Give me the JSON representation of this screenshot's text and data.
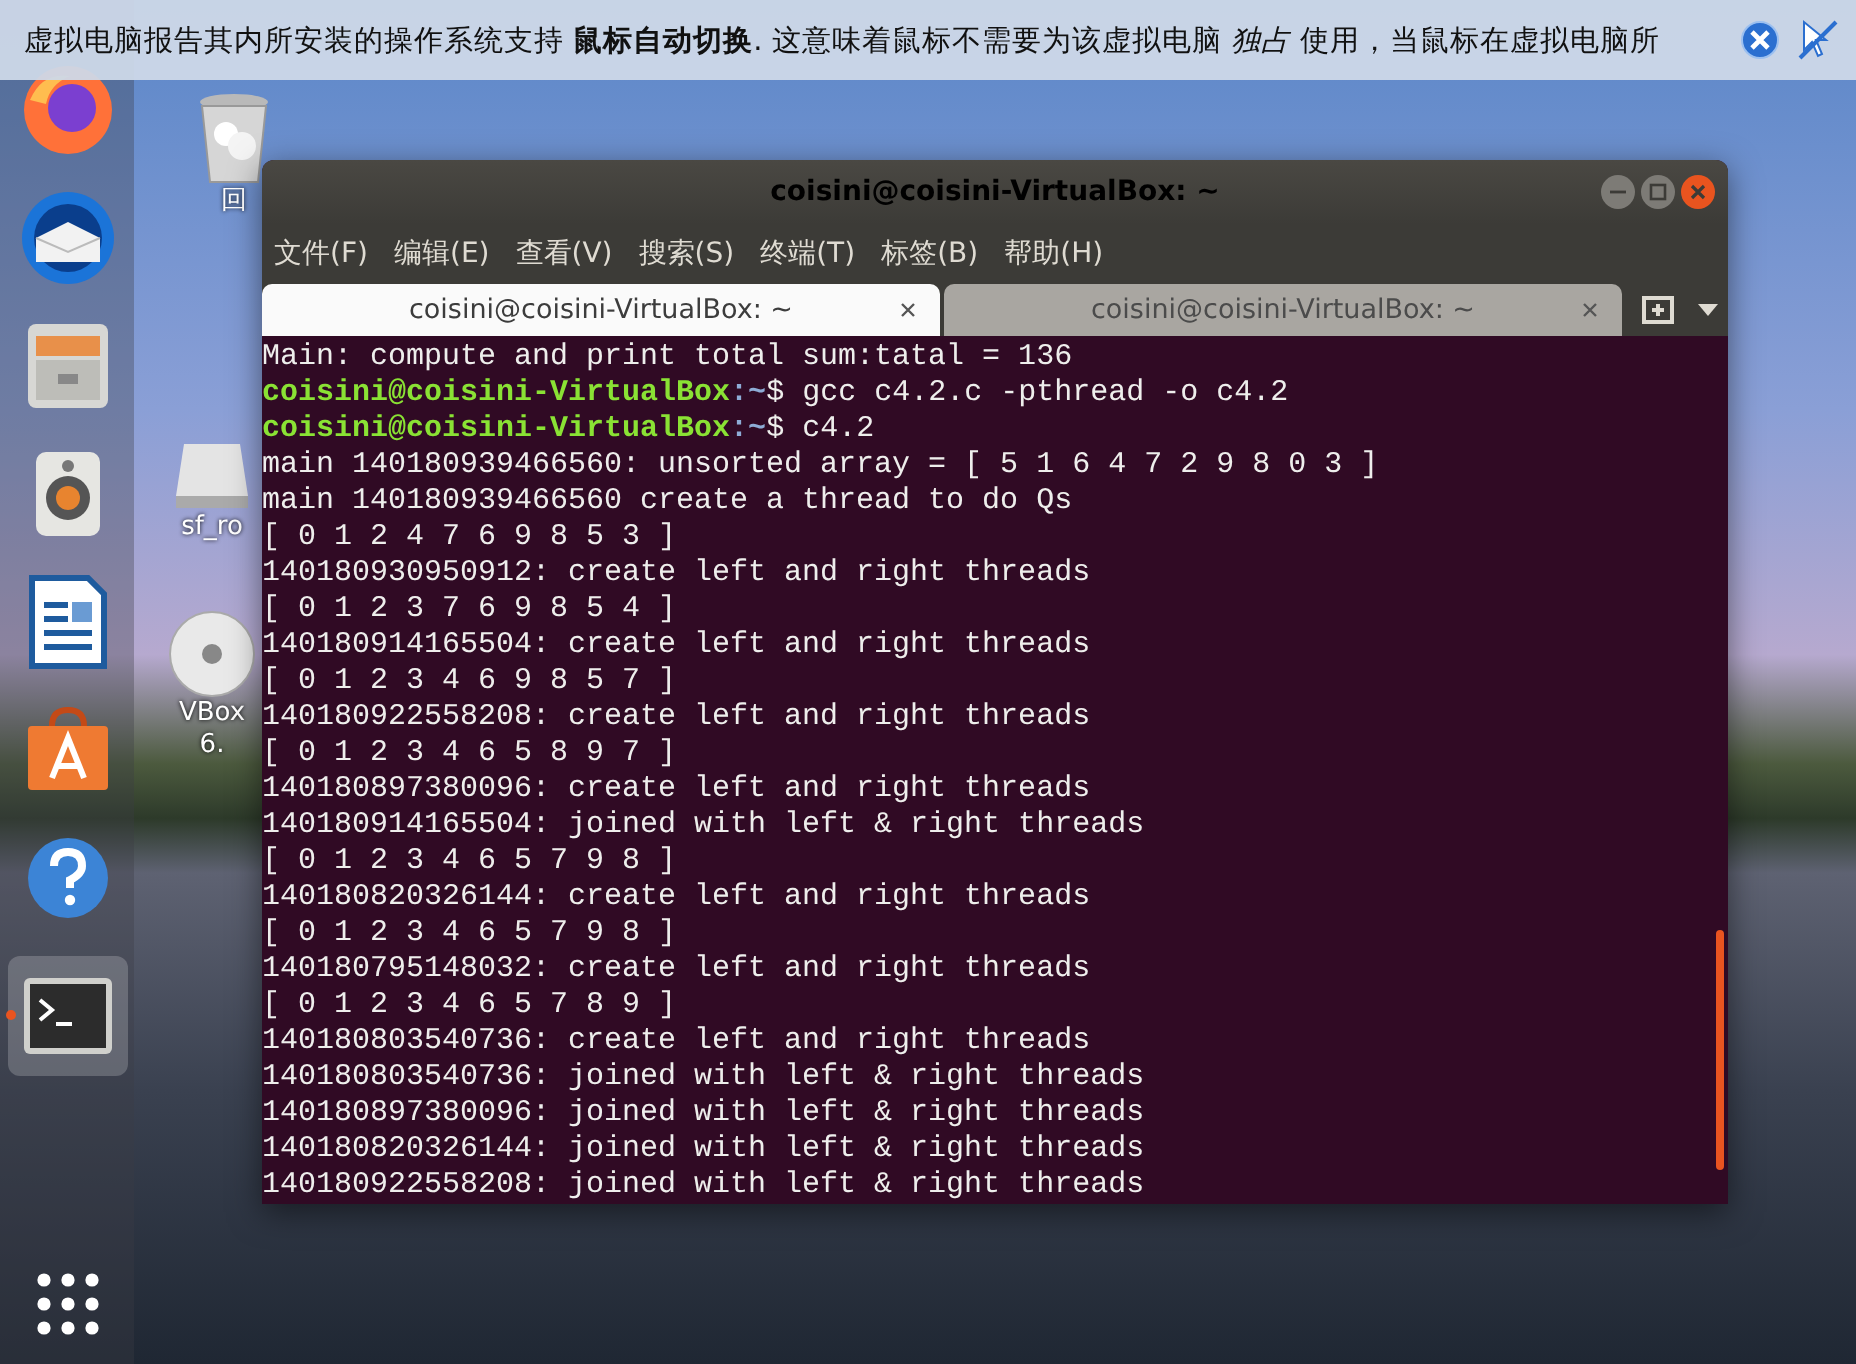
{
  "notification": {
    "message": "虚拟电脑报告其内所安装的操作系统支持 **鼠标自动切换**. 这意味着鼠标不需要为该虚拟电脑 *独占* 使用，当鼠标在虚拟电脑所"
  },
  "dock": {
    "items": [
      {
        "kind": "firefox",
        "selected": false
      },
      {
        "kind": "mail",
        "selected": false
      },
      {
        "kind": "files",
        "selected": false
      },
      {
        "kind": "music",
        "selected": false
      },
      {
        "kind": "writer",
        "selected": false
      },
      {
        "kind": "store",
        "selected": false
      },
      {
        "kind": "help",
        "selected": false
      },
      {
        "kind": "terminal",
        "selected": true
      }
    ]
  },
  "desktop_icons": [
    {
      "kind": "trash",
      "label": "回"
    },
    {
      "kind": "drive",
      "label": "sf_ro"
    },
    {
      "kind": "disc",
      "label": "VBox",
      "label_2": "6."
    }
  ],
  "window": {
    "title": "coisini@coisini-VirtualBox: ~",
    "menu": [
      "文件(F)",
      "编辑(E)",
      "查看(V)",
      "搜索(S)",
      "终端(T)",
      "标签(B)",
      "帮助(H)"
    ],
    "tabs": [
      {
        "label": "coisini@coisini-VirtualBox: ~",
        "selected": true
      },
      {
        "label": "coisini@coisini-VirtualBox: ~",
        "selected": false
      }
    ],
    "lines": [
      {
        "kind": "output",
        "text": "Main: compute and print total sum:tatal = 136"
      },
      {
        "kind": "prompt",
        "user": "coisini@coisini-VirtualBox",
        "path": ":~",
        "command": "$ gcc c4.2.c -pthread -o c4.2"
      },
      {
        "kind": "prompt",
        "user": "coisini@coisini-VirtualBox",
        "path": ":~",
        "command": "$ c4.2"
      },
      {
        "kind": "output",
        "text": "main 140180939466560: unsorted array = [ 5 1 6 4 7 2 9 8 0 3 ]"
      },
      {
        "kind": "output",
        "text": "main 140180939466560 create a thread to do Qs"
      },
      {
        "kind": "output",
        "text": "[ 0 1 2 4 7 6 9 8 5 3 ]"
      },
      {
        "kind": "output",
        "text": "140180930950912: create left and right threads"
      },
      {
        "kind": "output",
        "text": "[ 0 1 2 3 7 6 9 8 5 4 ]"
      },
      {
        "kind": "output",
        "text": "140180914165504: create left and right threads"
      },
      {
        "kind": "output",
        "text": "[ 0 1 2 3 4 6 9 8 5 7 ]"
      },
      {
        "kind": "output",
        "text": "140180922558208: create left and right threads"
      },
      {
        "kind": "output",
        "text": "[ 0 1 2 3 4 6 5 8 9 7 ]"
      },
      {
        "kind": "output",
        "text": "140180897380096: create left and right threads"
      },
      {
        "kind": "output",
        "text": "140180914165504: joined with left & right threads"
      },
      {
        "kind": "output",
        "text": "[ 0 1 2 3 4 6 5 7 9 8 ]"
      },
      {
        "kind": "output",
        "text": "140180820326144: create left and right threads"
      },
      {
        "kind": "output",
        "text": "[ 0 1 2 3 4 6 5 7 9 8 ]"
      },
      {
        "kind": "output",
        "text": "140180795148032: create left and right threads"
      },
      {
        "kind": "output",
        "text": "[ 0 1 2 3 4 6 5 7 8 9 ]"
      },
      {
        "kind": "output",
        "text": "140180803540736: create left and right threads"
      },
      {
        "kind": "output",
        "text": "140180803540736: joined with left & right threads"
      },
      {
        "kind": "output",
        "text": "140180897380096: joined with left & right threads"
      },
      {
        "kind": "output",
        "text": "140180820326144: joined with left & right threads"
      },
      {
        "kind": "output",
        "text": "140180922558208: joined with left & right threads"
      }
    ]
  }
}
